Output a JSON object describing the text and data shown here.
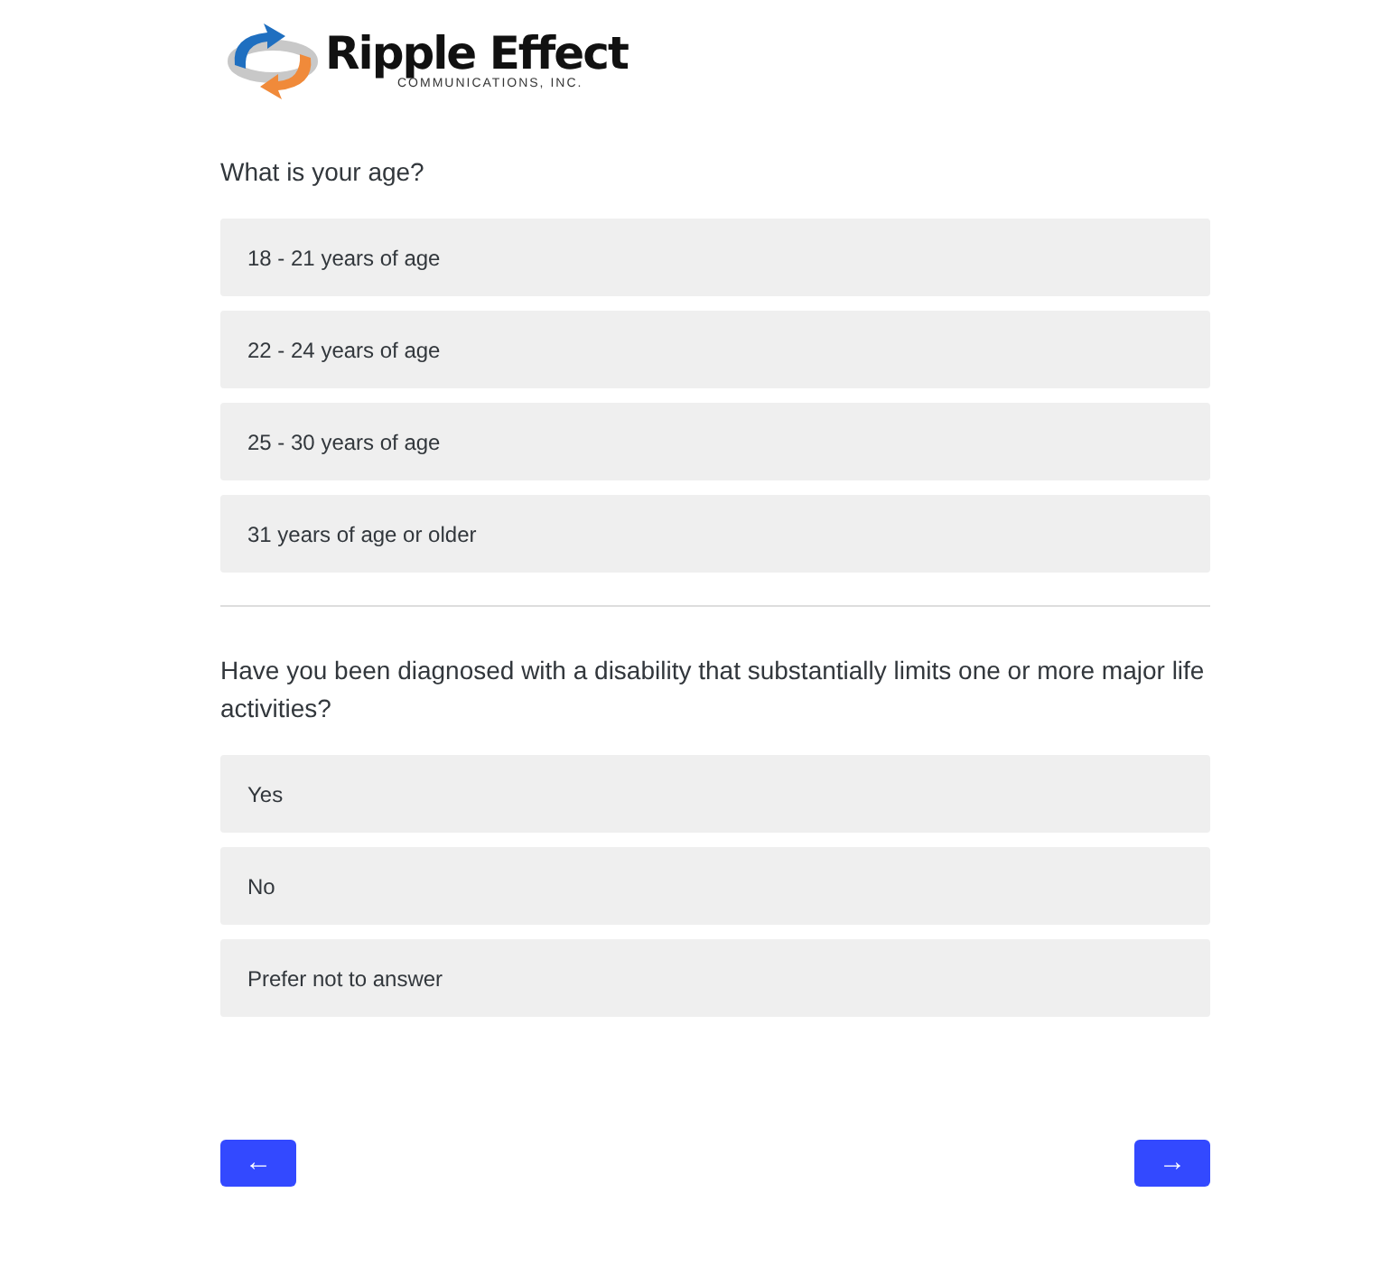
{
  "logo": {
    "name": "Ripple Effect",
    "tagline": "COMMUNICATIONS, INC."
  },
  "questions": [
    {
      "text": "What is your age?",
      "options": [
        {
          "label": "18 - 21 years of age",
          "selected": false
        },
        {
          "label": "22 - 24 years of age",
          "selected": false
        },
        {
          "label": "25 - 30 years of age",
          "selected": false
        },
        {
          "label": "31 years of age or older",
          "selected": false
        }
      ]
    },
    {
      "text": "Have you been diagnosed with a disability that substantially limits one or more major life activities?",
      "options": [
        {
          "label": "Yes",
          "selected": false
        },
        {
          "label": "No",
          "selected": false
        },
        {
          "label": "Prefer not to answer",
          "selected": false
        }
      ]
    }
  ],
  "nav": {
    "back": "←",
    "next": "→"
  }
}
